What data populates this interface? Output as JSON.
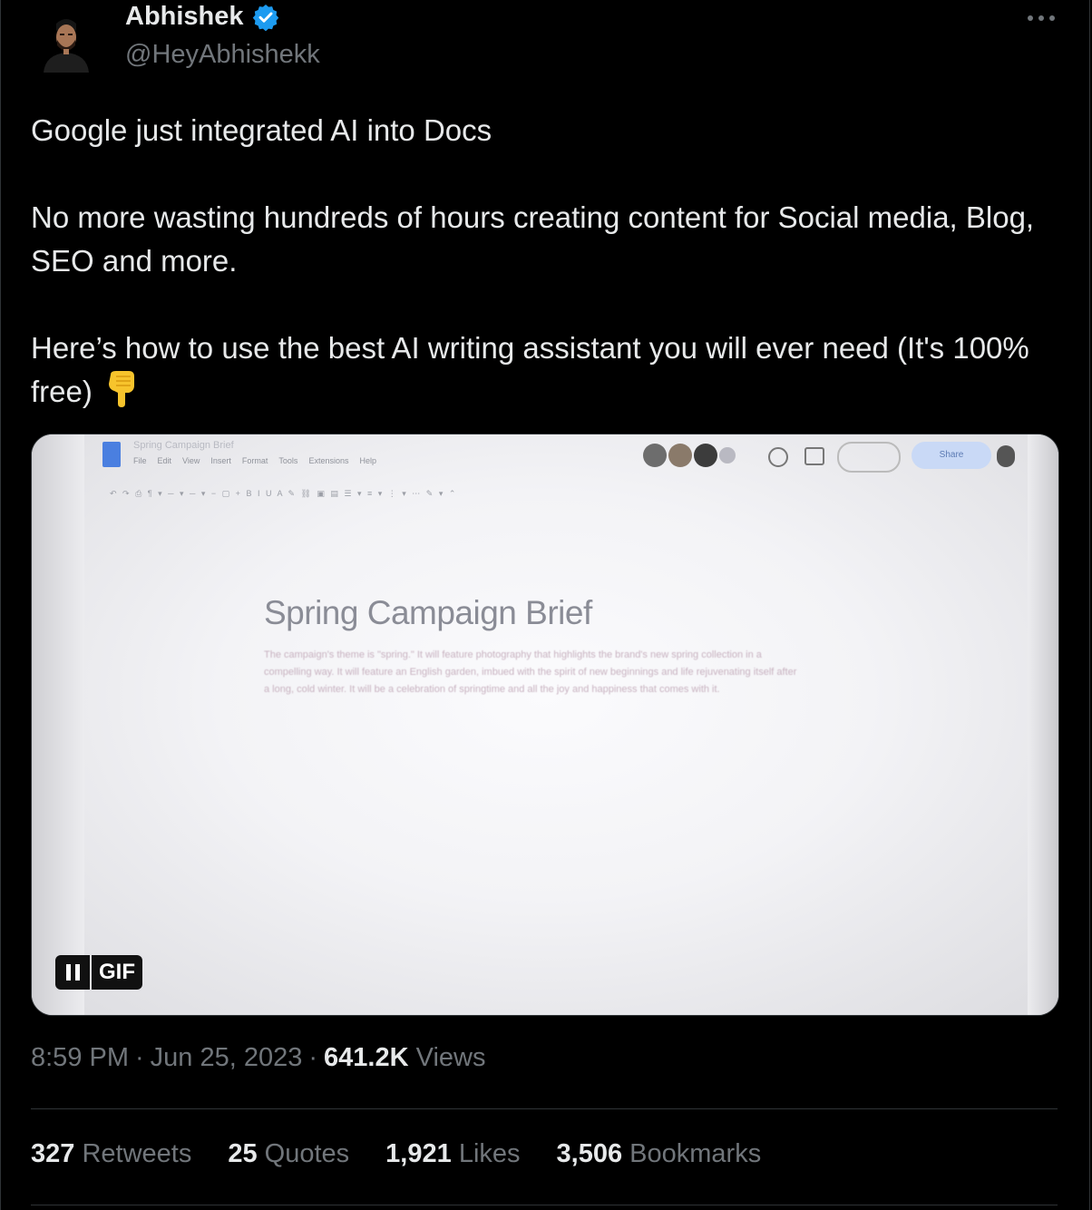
{
  "author": {
    "display_name": "Abhishek",
    "handle": "@HeyAbhishekk"
  },
  "tweet": {
    "line1": "Google just integrated AI into Docs",
    "line2": "No more wasting hundreds of hours creating content for Social media, Blog, SEO and more.",
    "line3": "Here’s how to use the best AI writing assistant you will ever need (It's 100% free)",
    "emoji": "👇"
  },
  "media": {
    "doc_title_small": "Spring Campaign Brief",
    "doc_menu": [
      "File",
      "Edit",
      "View",
      "Insert",
      "Format",
      "Tools",
      "Extensions",
      "Help"
    ],
    "doc_heading": "Spring Campaign Brief",
    "doc_body": "The campaign's theme is \"spring.\" It will feature photography that highlights the brand's new spring collection in a compelling way. It will feature an English garden, imbued with the spirit of new beginnings and life rejuvenating itself after a long, cold winter. It will be a celebration of springtime and all the joy and happiness that comes with it.",
    "share_label": "Share",
    "gif_label": "GIF"
  },
  "meta": {
    "time": "8:59 PM",
    "date": "Jun 25, 2023",
    "views_count": "641.2K",
    "views_label": "Views"
  },
  "stats": {
    "retweets_count": "327",
    "retweets_label": "Retweets",
    "quotes_count": "25",
    "quotes_label": "Quotes",
    "likes_count": "1,921",
    "likes_label": "Likes",
    "bookmarks_count": "3,506",
    "bookmarks_label": "Bookmarks"
  },
  "colors": {
    "background": "#000000",
    "text": "#e7e9ea",
    "muted": "#71767b",
    "verified": "#1d9bf0"
  },
  "icons": [
    "avatar",
    "verified-badge-icon",
    "more-options-icon",
    "pointing-down-emoji",
    "pause-icon"
  ]
}
